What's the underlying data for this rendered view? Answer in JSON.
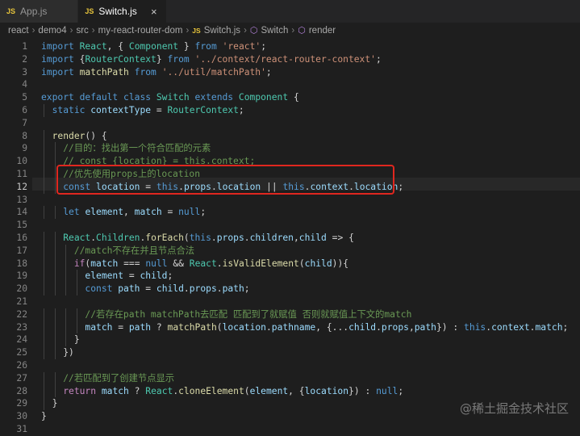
{
  "tabs": [
    {
      "icon": "JS",
      "label": "App.js",
      "active": false
    },
    {
      "icon": "JS",
      "label": "Switch.js",
      "active": true
    }
  ],
  "close_glyph": "×",
  "breadcrumb": {
    "parts": [
      "react",
      "demo4",
      "src",
      "my-react-router-dom"
    ],
    "file_icon": "JS",
    "file": "Switch.js",
    "class": "Switch",
    "method": "render"
  },
  "code_lines": [
    "import React, { Component } from 'react';",
    "import {RouterContext} from '../context/react-router-context';",
    "import matchPath from '../util/matchPath';",
    "",
    "export default class Switch extends Component {",
    "  static contextType = RouterContext;",
    "",
    "  render() {",
    "    //目的：找出第一个符合匹配的元素",
    "    // const {location} = this.context;",
    "    //优先使用props上的location",
    "    const location = this.props.location || this.context.location;",
    "",
    "    let element, match = null;",
    "",
    "    React.Children.forEach(this.props.children,child => {",
    "      //match不存在并且节点合法",
    "      if(match === null && React.isValidElement(child)){",
    "        element = child;",
    "        const path = child.props.path;",
    "",
    "        //若存在path matchPath去匹配 匹配到了就赋值 否则就赋值上下文的match",
    "        match = path ? matchPath(location.pathname, {...child.props,path}) : this.context.match;",
    "      }",
    "    })",
    "",
    "    //若匹配到了创建节点显示",
    "    return match ? React.cloneElement(element, {location}) : null;",
    "  }",
    "}",
    ""
  ],
  "current_line": 12,
  "highlighted_lines": [
    11,
    12
  ],
  "highlight_color": "#e0271f",
  "watermark": "@稀土掘金技术社区"
}
